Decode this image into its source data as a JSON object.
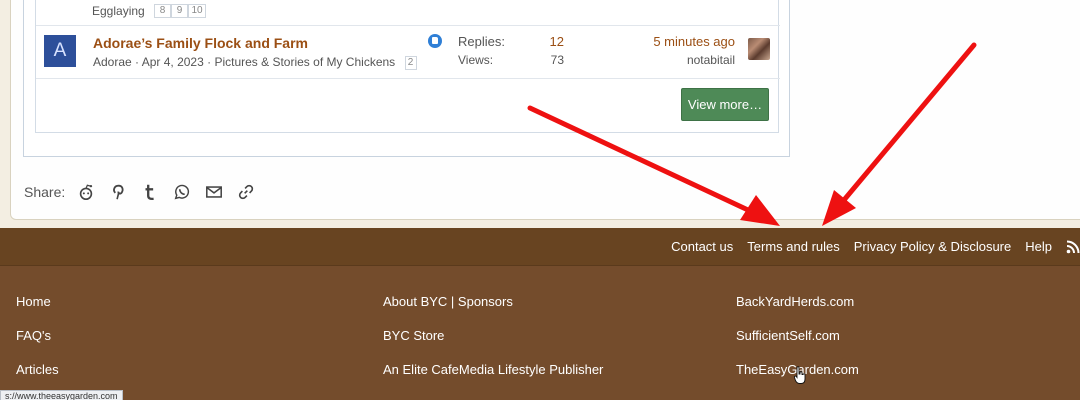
{
  "thread_top": {
    "label": "Egglaying",
    "pages": [
      "8",
      "9",
      "10"
    ]
  },
  "thread": {
    "avatar_letter": "A",
    "title": "Adorae’s Family Flock and Farm",
    "author": "Adorae",
    "date": "Apr 4, 2023",
    "forum": "Pictures & Stories of My Chickens",
    "page": "2",
    "replies_label": "Replies:",
    "replies": "12",
    "views_label": "Views:",
    "views": "73",
    "last_time": "5 minutes ago",
    "last_user": "notabitail"
  },
  "view_more": "View more…",
  "share": {
    "label": "Share:",
    "icons": [
      "reddit-icon",
      "pinterest-icon",
      "tumblr-icon",
      "whatsapp-icon",
      "email-icon",
      "link-icon"
    ]
  },
  "footer_top": {
    "links": [
      "Contact us",
      "Terms and rules",
      "Privacy Policy & Disclosure",
      "Help"
    ]
  },
  "footer": {
    "col1": [
      "Home",
      "FAQ's",
      "Articles"
    ],
    "col2": [
      "About BYC | Sponsors",
      "BYC Store",
      "An Elite CafeMedia Lifestyle Publisher"
    ],
    "col3": [
      "BackYardHerds.com",
      "SufficientSelf.com",
      "TheEasyGarden.com"
    ]
  },
  "status_url": "s://www.theeasygarden.com",
  "colors": {
    "title": "#9b4f14",
    "button": "#4e8a57",
    "footer_top": "#684421",
    "footer_main": "#744c2c",
    "arrow": "#ee1111"
  }
}
